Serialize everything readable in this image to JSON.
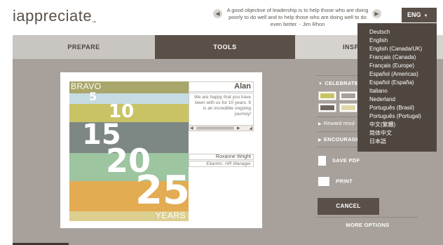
{
  "header": {
    "logo_text": "iappreciate",
    "logo_tm": "™",
    "quote": "A good objective of leadership is to help those who are doing poorly to do well and to help those who are doing well to do even better. - Jim Rhon",
    "prev_icon": "chevron-left-icon",
    "next_icon": "chevron-right-icon",
    "language_label": "ENG"
  },
  "nav": {
    "tabs": [
      {
        "label": "PREPARE"
      },
      {
        "label": "TOOLS"
      },
      {
        "label": "INSP"
      }
    ]
  },
  "card": {
    "art_top_label": "BRAVO",
    "art_bottom_label": "YEARS",
    "art_numbers": [
      "5",
      "10",
      "15",
      "20",
      "25"
    ],
    "recipient_name": "Alan",
    "message": "We are happy that you have been with us for 10 years. It is an incredible ongoing journey!",
    "signer_name": "Roxanne Wright",
    "signer_title": "ElianInc. HR Manager"
  },
  "panel": {
    "celebrate_label": "CELEBRATE",
    "reward_label": "Reward resul",
    "encourage_label": "ENCOURAGE",
    "save_pdf_label": "SAVE PDF",
    "print_label": "PRINT",
    "cancel_label": "CANCEL",
    "more_options_label": "MORE OPTIONS"
  },
  "language_menu": {
    "items": [
      "Deutsch",
      "English",
      "English (Canada/UK)",
      "Français (Canada)",
      "Français (Europe)",
      "Español (Americas)",
      "Español (España)",
      "Italiano",
      "Nederland",
      "Português (Brasil)",
      "Português (Portugal)",
      "中文(繁體)",
      "简体中文",
      "日本語"
    ]
  },
  "colors": {
    "brand_dark": "#5a5048",
    "brand_accent": "#c8801e",
    "main_bg": "#a8a19b",
    "dropdown_bg": "#4f463f"
  }
}
